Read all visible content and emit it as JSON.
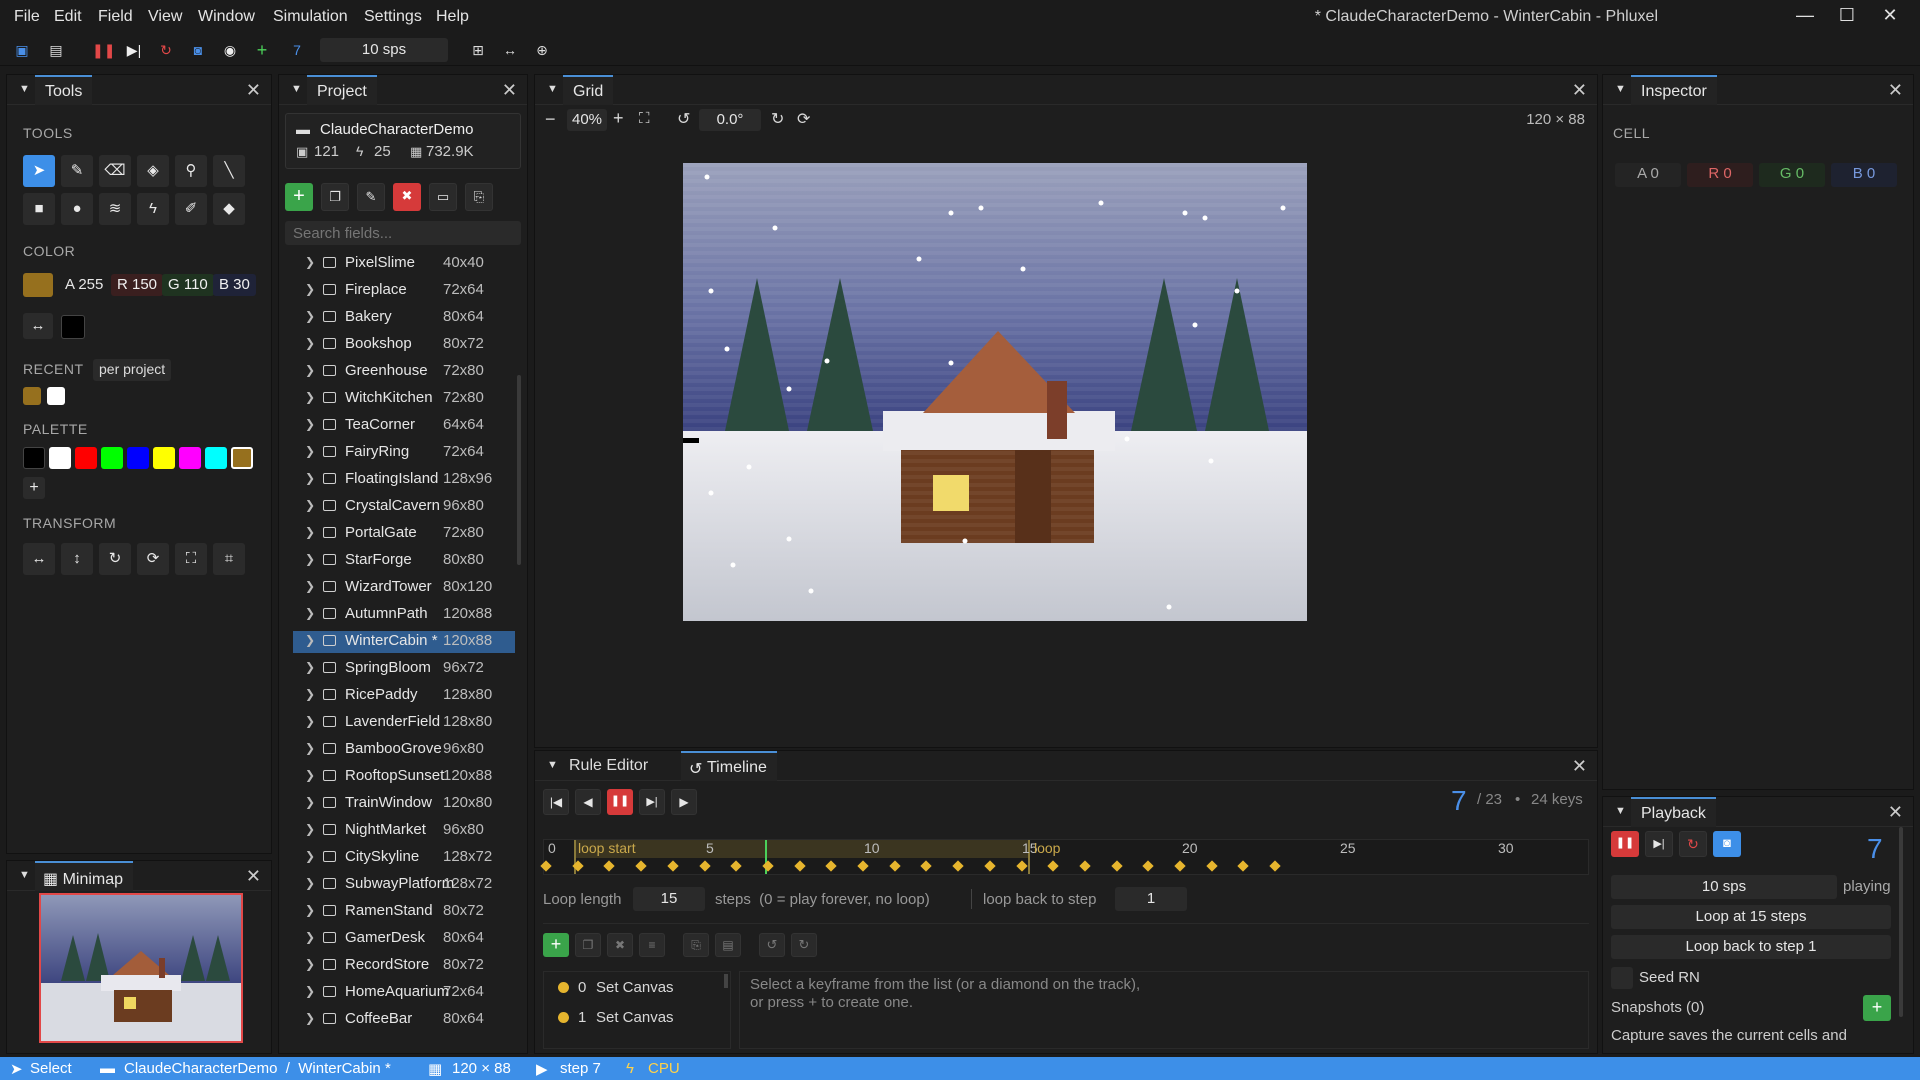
{
  "menu": [
    "File",
    "Edit",
    "Field",
    "View",
    "Window",
    "Simulation",
    "Settings",
    "Help"
  ],
  "window_title": "* ClaudeCharacterDemo - WinterCabin - Phluxel",
  "toolbar": {
    "step": "7",
    "sps": "10 sps"
  },
  "tools_panel": {
    "title": "Tools",
    "tools_label": "TOOLS",
    "color_label": "COLOR",
    "color": {
      "a": "A 255",
      "r": "R 150",
      "g": "G 110",
      "b": "B 30",
      "hex": "#96701e"
    },
    "recent_label": "RECENT",
    "recent_scope": "per project",
    "palette_label": "PALETTE",
    "palette": [
      "#000000",
      "#ffffff",
      "#ff0000",
      "#00ff00",
      "#0000ff",
      "#ffff00",
      "#ff00ff",
      "#00ffff",
      "#96701e"
    ],
    "transform_label": "TRANSFORM"
  },
  "minimap": {
    "title": "Minimap"
  },
  "project": {
    "title": "Project",
    "name": "ClaudeCharacterDemo",
    "stats": {
      "images": "121",
      "rules": "25",
      "cells": "732.9K"
    },
    "search_placeholder": "Search fields...",
    "items": [
      {
        "name": "PixelSlime",
        "size": "40x40"
      },
      {
        "name": "Fireplace",
        "size": "72x64"
      },
      {
        "name": "Bakery",
        "size": "80x64"
      },
      {
        "name": "Bookshop",
        "size": "80x72"
      },
      {
        "name": "Greenhouse",
        "size": "72x80"
      },
      {
        "name": "WitchKitchen",
        "size": "72x80"
      },
      {
        "name": "TeaCorner",
        "size": "64x64"
      },
      {
        "name": "FairyRing",
        "size": "72x64"
      },
      {
        "name": "FloatingIsland",
        "size": "128x96"
      },
      {
        "name": "CrystalCavern",
        "size": "96x80"
      },
      {
        "name": "PortalGate",
        "size": "72x80"
      },
      {
        "name": "StarForge",
        "size": "80x80"
      },
      {
        "name": "WizardTower",
        "size": "80x120"
      },
      {
        "name": "AutumnPath",
        "size": "120x88"
      },
      {
        "name": "WinterCabin *",
        "size": "120x88"
      },
      {
        "name": "SpringBloom",
        "size": "96x72"
      },
      {
        "name": "RicePaddy",
        "size": "128x80"
      },
      {
        "name": "LavenderField",
        "size": "128x80"
      },
      {
        "name": "BambooGrove",
        "size": "96x80"
      },
      {
        "name": "RooftopSunset",
        "size": "120x88"
      },
      {
        "name": "TrainWindow",
        "size": "120x80"
      },
      {
        "name": "NightMarket",
        "size": "96x80"
      },
      {
        "name": "CitySkyline",
        "size": "128x72"
      },
      {
        "name": "SubwayPlatform",
        "size": "128x72"
      },
      {
        "name": "RamenStand",
        "size": "80x72"
      },
      {
        "name": "GamerDesk",
        "size": "80x64"
      },
      {
        "name": "RecordStore",
        "size": "80x72"
      },
      {
        "name": "HomeAquarium",
        "size": "72x64"
      },
      {
        "name": "CoffeeBar",
        "size": "80x64"
      }
    ]
  },
  "grid": {
    "title": "Grid",
    "zoom": "40%",
    "rotation": "0.0°",
    "dims": "120 × 88"
  },
  "bottom": {
    "tabs": [
      "Rule Editor",
      "Timeline"
    ],
    "step": "7",
    "total": "/ 23",
    "keys": "24 keys",
    "ticks": [
      "0",
      "5",
      "10",
      "15",
      "20",
      "25",
      "30"
    ],
    "loop_start": "loop start",
    "loop_end": "loop",
    "loop_length_label": "Loop length",
    "loop_length": "15",
    "steps_hint": "steps  (0 = play forever, no loop)",
    "loop_back_label": "loop back to step",
    "loop_back": "1",
    "keyframes": [
      {
        "idx": "0",
        "label": "Set Canvas"
      },
      {
        "idx": "1",
        "label": "Set Canvas"
      }
    ],
    "hint1": "Select a keyframe from the list (or a diamond on the track),",
    "hint2": "or press + to create one."
  },
  "inspector": {
    "title": "Inspector",
    "cell_label": "CELL",
    "a": "A 0",
    "r": "R 0",
    "g": "G 0",
    "b": "B 0"
  },
  "playback": {
    "title": "Playback",
    "step": "7",
    "sps": "10 sps",
    "state": "playing",
    "loop_at": "Loop at 15 steps",
    "loop_back": "Loop back to step 1",
    "seed": "Seed RN",
    "snapshots": "Snapshots (0)",
    "capture_hint": "Capture saves the current cells and"
  },
  "status": {
    "tool": "Select",
    "path": "ClaudeCharacterDemo  /  WinterCabin *",
    "dims": "120 × 88",
    "step": "step 7",
    "backend": "CPU"
  }
}
